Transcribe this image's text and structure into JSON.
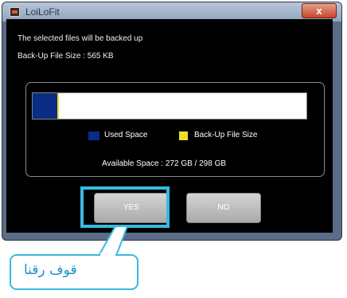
{
  "window": {
    "title": "LoiLoFit",
    "close_glyph": "x",
    "icon": "app-icon"
  },
  "dialog": {
    "message": "The selected files will be backed up",
    "backup_size_text": "Back-Up File Size : 565 KB",
    "available_text": "Available Space : 272 GB / 298 GB",
    "legend": {
      "used_label": "Used Space",
      "backup_label": "Back-Up File Size"
    },
    "usage": {
      "used_fraction": 0.091,
      "backup_fraction": 0.004
    },
    "buttons": {
      "yes_label": "YES",
      "no_label": "NO"
    }
  },
  "callout": {
    "text": "قوف رقنا"
  },
  "colors": {
    "used": "#0a2c85",
    "backup": "#e8df2e",
    "highlight": "#3ab9de",
    "callout_text": "#1c90c8"
  }
}
